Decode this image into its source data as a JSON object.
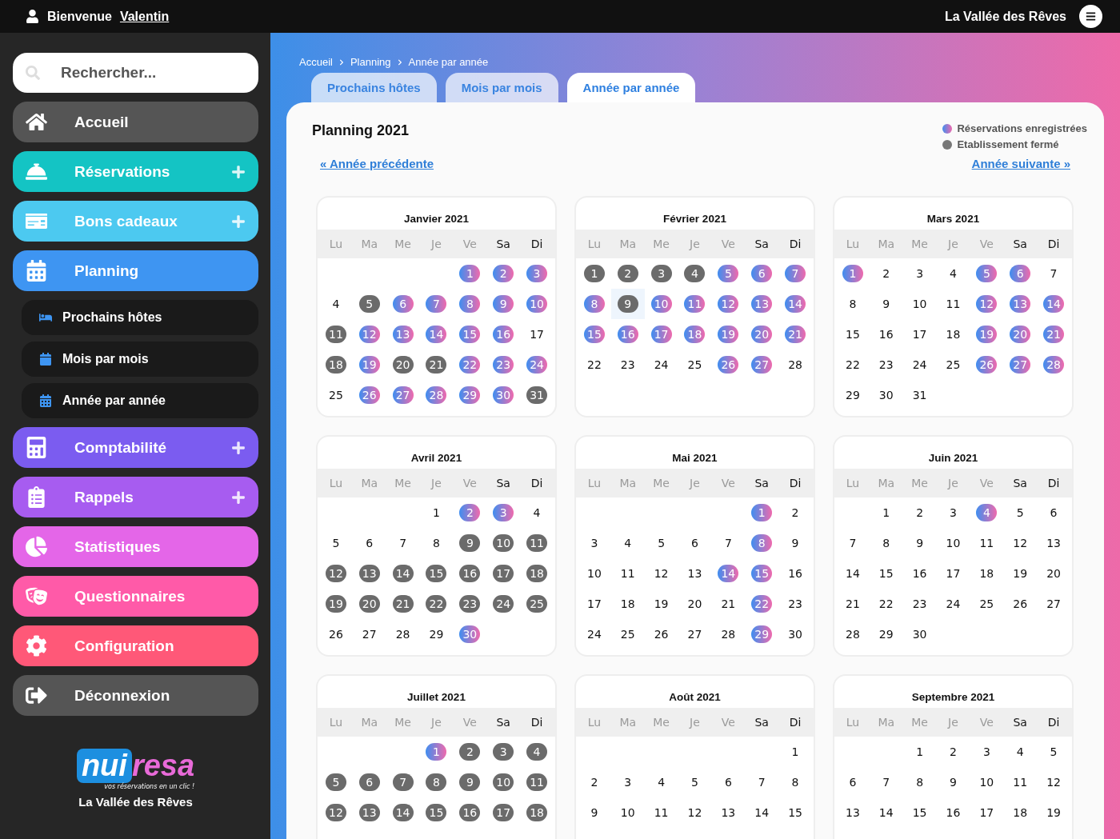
{
  "topbar": {
    "greeting": "Bienvenue",
    "user": "Valentin",
    "site": "La Vallée des Rêves"
  },
  "sidebar": {
    "search": {
      "placeholder": "Rechercher..."
    },
    "items": [
      {
        "label": "Accueil",
        "kind": "home",
        "color": "#555555",
        "expandable": false
      },
      {
        "label": "Réservations",
        "kind": "bell",
        "color": "#14c4c4",
        "expandable": true
      },
      {
        "label": "Bons cadeaux",
        "kind": "voucher",
        "color": "#4cc9f0",
        "expandable": true
      },
      {
        "label": "Planning",
        "kind": "calendar",
        "color": "#3e95f2",
        "expandable": false,
        "children": [
          {
            "label": "Prochains hôtes",
            "kind": "bed"
          },
          {
            "label": "Mois par mois",
            "kind": "calendar-small"
          },
          {
            "label": "Année par année",
            "kind": "calendar-grid"
          }
        ]
      },
      {
        "label": "Comptabilité",
        "kind": "calculator",
        "color": "#7b5cf0",
        "expandable": true
      },
      {
        "label": "Rappels",
        "kind": "clipboard",
        "color": "#a75cf0",
        "expandable": true
      },
      {
        "label": "Statistiques",
        "kind": "pie",
        "color": "#e466e8",
        "expandable": false
      },
      {
        "label": "Questionnaires",
        "kind": "masks",
        "color": "#ff5aa8",
        "expandable": false
      },
      {
        "label": "Configuration",
        "kind": "gear",
        "color": "#ff5878",
        "expandable": false
      },
      {
        "label": "Déconnexion",
        "kind": "logout",
        "color": "#555555",
        "expandable": false
      }
    ],
    "logo": {
      "part1": "nui",
      "part2": "resa",
      "tagline": "vos réservations en un clic !"
    },
    "footer": "La Vallée des Rêves"
  },
  "breadcrumb": [
    "Accueil",
    "Planning",
    "Année par année"
  ],
  "tabs": [
    {
      "label": "Prochains hôtes",
      "selected": false
    },
    {
      "label": "Mois par mois",
      "selected": false
    },
    {
      "label": "Année par année",
      "selected": true
    }
  ],
  "planning": {
    "title": "Planning 2021",
    "legend": [
      {
        "label": "Réservations enregistrées",
        "kind": "reserved"
      },
      {
        "label": "Etablissement fermé",
        "kind": "closed"
      }
    ],
    "prev": "« Année précédente",
    "next": "Année suivante »",
    "months": [
      {
        "title": "Janvier 2021",
        "weekdays": [
          {
            "label": "Lu",
            "weekend": false
          },
          {
            "label": "Ma",
            "weekend": false
          },
          {
            "label": "Me",
            "weekend": false
          },
          {
            "label": "Je",
            "weekend": false
          },
          {
            "label": "Ve",
            "weekend": false
          },
          {
            "label": "Sa",
            "weekend": true
          },
          {
            "label": "Di",
            "weekend": true
          }
        ],
        "weeks": [
          [
            {
              "kind": "blank"
            },
            {
              "kind": "blank"
            },
            {
              "kind": "blank"
            },
            {
              "kind": "blank"
            },
            {
              "day": "1",
              "kind": "reserved"
            },
            {
              "day": "2",
              "kind": "reserved"
            },
            {
              "day": "3",
              "kind": "reserved"
            }
          ],
          [
            {
              "day": "4",
              "kind": "free"
            },
            {
              "day": "5",
              "kind": "closed"
            },
            {
              "day": "6",
              "kind": "reserved"
            },
            {
              "day": "7",
              "kind": "reserved"
            },
            {
              "day": "8",
              "kind": "reserved"
            },
            {
              "day": "9",
              "kind": "reserved"
            },
            {
              "day": "10",
              "kind": "reserved"
            }
          ],
          [
            {
              "day": "11",
              "kind": "closed"
            },
            {
              "day": "12",
              "kind": "reserved"
            },
            {
              "day": "13",
              "kind": "reserved"
            },
            {
              "day": "14",
              "kind": "reserved"
            },
            {
              "day": "15",
              "kind": "reserved"
            },
            {
              "day": "16",
              "kind": "reserved"
            },
            {
              "day": "17",
              "kind": "free"
            }
          ],
          [
            {
              "day": "18",
              "kind": "closed"
            },
            {
              "day": "19",
              "kind": "reserved"
            },
            {
              "day": "20",
              "kind": "closed"
            },
            {
              "day": "21",
              "kind": "closed"
            },
            {
              "day": "22",
              "kind": "reserved"
            },
            {
              "day": "23",
              "kind": "reserved"
            },
            {
              "day": "24",
              "kind": "reserved"
            }
          ],
          [
            {
              "day": "25",
              "kind": "free"
            },
            {
              "day": "26",
              "kind": "reserved"
            },
            {
              "day": "27",
              "kind": "reserved"
            },
            {
              "day": "28",
              "kind": "reserved"
            },
            {
              "day": "29",
              "kind": "reserved"
            },
            {
              "day": "30",
              "kind": "reserved"
            },
            {
              "day": "31",
              "kind": "closed"
            }
          ]
        ]
      },
      {
        "title": "Février 2021",
        "weekdays": [
          {
            "label": "Lu",
            "weekend": false
          },
          {
            "label": "Ma",
            "weekend": false
          },
          {
            "label": "Me",
            "weekend": false
          },
          {
            "label": "Je",
            "weekend": false
          },
          {
            "label": "Ve",
            "weekend": false
          },
          {
            "label": "Sa",
            "weekend": true
          },
          {
            "label": "Di",
            "weekend": true
          }
        ],
        "weeks": [
          [
            {
              "day": "1",
              "kind": "closed"
            },
            {
              "day": "2",
              "kind": "closed"
            },
            {
              "day": "3",
              "kind": "closed"
            },
            {
              "day": "4",
              "kind": "closed"
            },
            {
              "day": "5",
              "kind": "reserved"
            },
            {
              "day": "6",
              "kind": "reserved"
            },
            {
              "day": "7",
              "kind": "reserved"
            }
          ],
          [
            {
              "day": "8",
              "kind": "reserved"
            },
            {
              "day": "9",
              "kind": "closed",
              "today": true
            },
            {
              "day": "10",
              "kind": "reserved"
            },
            {
              "day": "11",
              "kind": "reserved"
            },
            {
              "day": "12",
              "kind": "reserved"
            },
            {
              "day": "13",
              "kind": "reserved"
            },
            {
              "day": "14",
              "kind": "reserved"
            }
          ],
          [
            {
              "day": "15",
              "kind": "reserved"
            },
            {
              "day": "16",
              "kind": "reserved"
            },
            {
              "day": "17",
              "kind": "reserved"
            },
            {
              "day": "18",
              "kind": "reserved"
            },
            {
              "day": "19",
              "kind": "reserved"
            },
            {
              "day": "20",
              "kind": "reserved"
            },
            {
              "day": "21",
              "kind": "reserved"
            }
          ],
          [
            {
              "day": "22",
              "kind": "free"
            },
            {
              "day": "23",
              "kind": "free"
            },
            {
              "day": "24",
              "kind": "free"
            },
            {
              "day": "25",
              "kind": "free"
            },
            {
              "day": "26",
              "kind": "reserved"
            },
            {
              "day": "27",
              "kind": "reserved"
            },
            {
              "day": "28",
              "kind": "free"
            }
          ]
        ]
      },
      {
        "title": "Mars 2021",
        "weekdays": [
          {
            "label": "Lu",
            "weekend": false
          },
          {
            "label": "Ma",
            "weekend": false
          },
          {
            "label": "Me",
            "weekend": false
          },
          {
            "label": "Je",
            "weekend": false
          },
          {
            "label": "Ve",
            "weekend": false
          },
          {
            "label": "Sa",
            "weekend": true
          },
          {
            "label": "Di",
            "weekend": true
          }
        ],
        "weeks": [
          [
            {
              "day": "1",
              "kind": "reserved"
            },
            {
              "day": "2",
              "kind": "free"
            },
            {
              "day": "3",
              "kind": "free"
            },
            {
              "day": "4",
              "kind": "free"
            },
            {
              "day": "5",
              "kind": "reserved"
            },
            {
              "day": "6",
              "kind": "reserved"
            },
            {
              "day": "7",
              "kind": "free"
            }
          ],
          [
            {
              "day": "8",
              "kind": "free"
            },
            {
              "day": "9",
              "kind": "free"
            },
            {
              "day": "10",
              "kind": "free"
            },
            {
              "day": "11",
              "kind": "free"
            },
            {
              "day": "12",
              "kind": "reserved"
            },
            {
              "day": "13",
              "kind": "reserved"
            },
            {
              "day": "14",
              "kind": "reserved"
            }
          ],
          [
            {
              "day": "15",
              "kind": "free"
            },
            {
              "day": "16",
              "kind": "free"
            },
            {
              "day": "17",
              "kind": "free"
            },
            {
              "day": "18",
              "kind": "free"
            },
            {
              "day": "19",
              "kind": "reserved"
            },
            {
              "day": "20",
              "kind": "reserved"
            },
            {
              "day": "21",
              "kind": "reserved"
            }
          ],
          [
            {
              "day": "22",
              "kind": "free"
            },
            {
              "day": "23",
              "kind": "free"
            },
            {
              "day": "24",
              "kind": "free"
            },
            {
              "day": "25",
              "kind": "free"
            },
            {
              "day": "26",
              "kind": "reserved"
            },
            {
              "day": "27",
              "kind": "reserved"
            },
            {
              "day": "28",
              "kind": "reserved"
            }
          ],
          [
            {
              "day": "29",
              "kind": "free"
            },
            {
              "day": "30",
              "kind": "free"
            },
            {
              "day": "31",
              "kind": "free"
            },
            {
              "kind": "blank"
            },
            {
              "kind": "blank"
            },
            {
              "kind": "blank"
            },
            {
              "kind": "blank"
            }
          ]
        ]
      },
      {
        "title": "Avril 2021",
        "weekdays": [
          {
            "label": "Lu",
            "weekend": false
          },
          {
            "label": "Ma",
            "weekend": false
          },
          {
            "label": "Me",
            "weekend": false
          },
          {
            "label": "Je",
            "weekend": false
          },
          {
            "label": "Ve",
            "weekend": false
          },
          {
            "label": "Sa",
            "weekend": true
          },
          {
            "label": "Di",
            "weekend": true
          }
        ],
        "weeks": [
          [
            {
              "kind": "blank"
            },
            {
              "kind": "blank"
            },
            {
              "kind": "blank"
            },
            {
              "day": "1",
              "kind": "free"
            },
            {
              "day": "2",
              "kind": "reserved"
            },
            {
              "day": "3",
              "kind": "reserved"
            },
            {
              "day": "4",
              "kind": "free"
            }
          ],
          [
            {
              "day": "5",
              "kind": "free"
            },
            {
              "day": "6",
              "kind": "free"
            },
            {
              "day": "7",
              "kind": "free"
            },
            {
              "day": "8",
              "kind": "free"
            },
            {
              "day": "9",
              "kind": "closed"
            },
            {
              "day": "10",
              "kind": "closed"
            },
            {
              "day": "11",
              "kind": "closed"
            }
          ],
          [
            {
              "day": "12",
              "kind": "closed"
            },
            {
              "day": "13",
              "kind": "closed"
            },
            {
              "day": "14",
              "kind": "closed"
            },
            {
              "day": "15",
              "kind": "closed"
            },
            {
              "day": "16",
              "kind": "closed"
            },
            {
              "day": "17",
              "kind": "closed"
            },
            {
              "day": "18",
              "kind": "closed"
            }
          ],
          [
            {
              "day": "19",
              "kind": "closed"
            },
            {
              "day": "20",
              "kind": "closed"
            },
            {
              "day": "21",
              "kind": "closed"
            },
            {
              "day": "22",
              "kind": "closed"
            },
            {
              "day": "23",
              "kind": "closed"
            },
            {
              "day": "24",
              "kind": "closed"
            },
            {
              "day": "25",
              "kind": "closed"
            }
          ],
          [
            {
              "day": "26",
              "kind": "free"
            },
            {
              "day": "27",
              "kind": "free"
            },
            {
              "day": "28",
              "kind": "free"
            },
            {
              "day": "29",
              "kind": "free"
            },
            {
              "day": "30",
              "kind": "reserved"
            },
            {
              "kind": "blank"
            },
            {
              "kind": "blank"
            }
          ]
        ]
      },
      {
        "title": "Mai 2021",
        "weekdays": [
          {
            "label": "Lu",
            "weekend": false
          },
          {
            "label": "Ma",
            "weekend": false
          },
          {
            "label": "Me",
            "weekend": false
          },
          {
            "label": "Je",
            "weekend": false
          },
          {
            "label": "Ve",
            "weekend": false
          },
          {
            "label": "Sa",
            "weekend": true
          },
          {
            "label": "Di",
            "weekend": true
          }
        ],
        "weeks": [
          [
            {
              "kind": "blank"
            },
            {
              "kind": "blank"
            },
            {
              "kind": "blank"
            },
            {
              "kind": "blank"
            },
            {
              "kind": "blank"
            },
            {
              "day": "1",
              "kind": "reserved"
            },
            {
              "day": "2",
              "kind": "free"
            }
          ],
          [
            {
              "day": "3",
              "kind": "free"
            },
            {
              "day": "4",
              "kind": "free"
            },
            {
              "day": "5",
              "kind": "free"
            },
            {
              "day": "6",
              "kind": "free"
            },
            {
              "day": "7",
              "kind": "free"
            },
            {
              "day": "8",
              "kind": "reserved"
            },
            {
              "day": "9",
              "kind": "free"
            }
          ],
          [
            {
              "day": "10",
              "kind": "free"
            },
            {
              "day": "11",
              "kind": "free"
            },
            {
              "day": "12",
              "kind": "free"
            },
            {
              "day": "13",
              "kind": "free"
            },
            {
              "day": "14",
              "kind": "reserved"
            },
            {
              "day": "15",
              "kind": "reserved"
            },
            {
              "day": "16",
              "kind": "free"
            }
          ],
          [
            {
              "day": "17",
              "kind": "free"
            },
            {
              "day": "18",
              "kind": "free"
            },
            {
              "day": "19",
              "kind": "free"
            },
            {
              "day": "20",
              "kind": "free"
            },
            {
              "day": "21",
              "kind": "free"
            },
            {
              "day": "22",
              "kind": "reserved"
            },
            {
              "day": "23",
              "kind": "free"
            }
          ],
          [
            {
              "day": "24",
              "kind": "free"
            },
            {
              "day": "25",
              "kind": "free"
            },
            {
              "day": "26",
              "kind": "free"
            },
            {
              "day": "27",
              "kind": "free"
            },
            {
              "day": "28",
              "kind": "free"
            },
            {
              "day": "29",
              "kind": "reserved"
            },
            {
              "day": "30",
              "kind": "free"
            }
          ]
        ]
      },
      {
        "title": "Juin 2021",
        "weekdays": [
          {
            "label": "Lu",
            "weekend": false
          },
          {
            "label": "Ma",
            "weekend": false
          },
          {
            "label": "Me",
            "weekend": false
          },
          {
            "label": "Je",
            "weekend": false
          },
          {
            "label": "Ve",
            "weekend": false
          },
          {
            "label": "Sa",
            "weekend": true
          },
          {
            "label": "Di",
            "weekend": true
          }
        ],
        "weeks": [
          [
            {
              "kind": "blank"
            },
            {
              "day": "1",
              "kind": "free"
            },
            {
              "day": "2",
              "kind": "free"
            },
            {
              "day": "3",
              "kind": "free"
            },
            {
              "day": "4",
              "kind": "reserved"
            },
            {
              "day": "5",
              "kind": "free"
            },
            {
              "day": "6",
              "kind": "free"
            }
          ],
          [
            {
              "day": "7",
              "kind": "free"
            },
            {
              "day": "8",
              "kind": "free"
            },
            {
              "day": "9",
              "kind": "free"
            },
            {
              "day": "10",
              "kind": "free"
            },
            {
              "day": "11",
              "kind": "free"
            },
            {
              "day": "12",
              "kind": "free"
            },
            {
              "day": "13",
              "kind": "free"
            }
          ],
          [
            {
              "day": "14",
              "kind": "free"
            },
            {
              "day": "15",
              "kind": "free"
            },
            {
              "day": "16",
              "kind": "free"
            },
            {
              "day": "17",
              "kind": "free"
            },
            {
              "day": "18",
              "kind": "free"
            },
            {
              "day": "19",
              "kind": "free"
            },
            {
              "day": "20",
              "kind": "free"
            }
          ],
          [
            {
              "day": "21",
              "kind": "free"
            },
            {
              "day": "22",
              "kind": "free"
            },
            {
              "day": "23",
              "kind": "free"
            },
            {
              "day": "24",
              "kind": "free"
            },
            {
              "day": "25",
              "kind": "free"
            },
            {
              "day": "26",
              "kind": "free"
            },
            {
              "day": "27",
              "kind": "free"
            }
          ],
          [
            {
              "day": "28",
              "kind": "free"
            },
            {
              "day": "29",
              "kind": "free"
            },
            {
              "day": "30",
              "kind": "free"
            },
            {
              "kind": "blank"
            },
            {
              "kind": "blank"
            },
            {
              "kind": "blank"
            },
            {
              "kind": "blank"
            }
          ]
        ]
      },
      {
        "title": "Juillet 2021",
        "weekdays": [
          {
            "label": "Lu",
            "weekend": false
          },
          {
            "label": "Ma",
            "weekend": false
          },
          {
            "label": "Me",
            "weekend": false
          },
          {
            "label": "Je",
            "weekend": false
          },
          {
            "label": "Ve",
            "weekend": false
          },
          {
            "label": "Sa",
            "weekend": true
          },
          {
            "label": "Di",
            "weekend": true
          }
        ],
        "weeks": [
          [
            {
              "kind": "blank"
            },
            {
              "kind": "blank"
            },
            {
              "kind": "blank"
            },
            {
              "day": "1",
              "kind": "reserved"
            },
            {
              "day": "2",
              "kind": "closed"
            },
            {
              "day": "3",
              "kind": "closed"
            },
            {
              "day": "4",
              "kind": "closed"
            }
          ],
          [
            {
              "day": "5",
              "kind": "closed"
            },
            {
              "day": "6",
              "kind": "closed"
            },
            {
              "day": "7",
              "kind": "closed"
            },
            {
              "day": "8",
              "kind": "closed"
            },
            {
              "day": "9",
              "kind": "closed"
            },
            {
              "day": "10",
              "kind": "closed"
            },
            {
              "day": "11",
              "kind": "closed"
            }
          ],
          [
            {
              "day": "12",
              "kind": "closed"
            },
            {
              "day": "13",
              "kind": "closed"
            },
            {
              "day": "14",
              "kind": "closed"
            },
            {
              "day": "15",
              "kind": "closed"
            },
            {
              "day": "16",
              "kind": "closed"
            },
            {
              "day": "17",
              "kind": "closed"
            },
            {
              "day": "18",
              "kind": "closed"
            }
          ]
        ]
      },
      {
        "title": "Août 2021",
        "weekdays": [
          {
            "label": "Lu",
            "weekend": false
          },
          {
            "label": "Ma",
            "weekend": false
          },
          {
            "label": "Me",
            "weekend": false
          },
          {
            "label": "Je",
            "weekend": false
          },
          {
            "label": "Ve",
            "weekend": false
          },
          {
            "label": "Sa",
            "weekend": true
          },
          {
            "label": "Di",
            "weekend": true
          }
        ],
        "weeks": [
          [
            {
              "kind": "blank"
            },
            {
              "kind": "blank"
            },
            {
              "kind": "blank"
            },
            {
              "kind": "blank"
            },
            {
              "kind": "blank"
            },
            {
              "kind": "blank"
            },
            {
              "day": "1",
              "kind": "free"
            }
          ],
          [
            {
              "day": "2",
              "kind": "free"
            },
            {
              "day": "3",
              "kind": "free"
            },
            {
              "day": "4",
              "kind": "free"
            },
            {
              "day": "5",
              "kind": "free"
            },
            {
              "day": "6",
              "kind": "free"
            },
            {
              "day": "7",
              "kind": "free"
            },
            {
              "day": "8",
              "kind": "free"
            }
          ],
          [
            {
              "day": "9",
              "kind": "free"
            },
            {
              "day": "10",
              "kind": "free"
            },
            {
              "day": "11",
              "kind": "free"
            },
            {
              "day": "12",
              "kind": "free"
            },
            {
              "day": "13",
              "kind": "free"
            },
            {
              "day": "14",
              "kind": "free"
            },
            {
              "day": "15",
              "kind": "free"
            }
          ]
        ]
      },
      {
        "title": "Septembre 2021",
        "weekdays": [
          {
            "label": "Lu",
            "weekend": false
          },
          {
            "label": "Ma",
            "weekend": false
          },
          {
            "label": "Me",
            "weekend": false
          },
          {
            "label": "Je",
            "weekend": false
          },
          {
            "label": "Ve",
            "weekend": false
          },
          {
            "label": "Sa",
            "weekend": true
          },
          {
            "label": "Di",
            "weekend": true
          }
        ],
        "weeks": [
          [
            {
              "kind": "blank"
            },
            {
              "kind": "blank"
            },
            {
              "day": "1",
              "kind": "free"
            },
            {
              "day": "2",
              "kind": "free"
            },
            {
              "day": "3",
              "kind": "free"
            },
            {
              "day": "4",
              "kind": "free"
            },
            {
              "day": "5",
              "kind": "free"
            }
          ],
          [
            {
              "day": "6",
              "kind": "free"
            },
            {
              "day": "7",
              "kind": "free"
            },
            {
              "day": "8",
              "kind": "free"
            },
            {
              "day": "9",
              "kind": "free"
            },
            {
              "day": "10",
              "kind": "free"
            },
            {
              "day": "11",
              "kind": "free"
            },
            {
              "day": "12",
              "kind": "free"
            }
          ],
          [
            {
              "day": "13",
              "kind": "free"
            },
            {
              "day": "14",
              "kind": "free"
            },
            {
              "day": "15",
              "kind": "free"
            },
            {
              "day": "16",
              "kind": "free"
            },
            {
              "day": "17",
              "kind": "free"
            },
            {
              "day": "18",
              "kind": "free"
            },
            {
              "day": "19",
              "kind": "free"
            }
          ]
        ]
      }
    ]
  }
}
